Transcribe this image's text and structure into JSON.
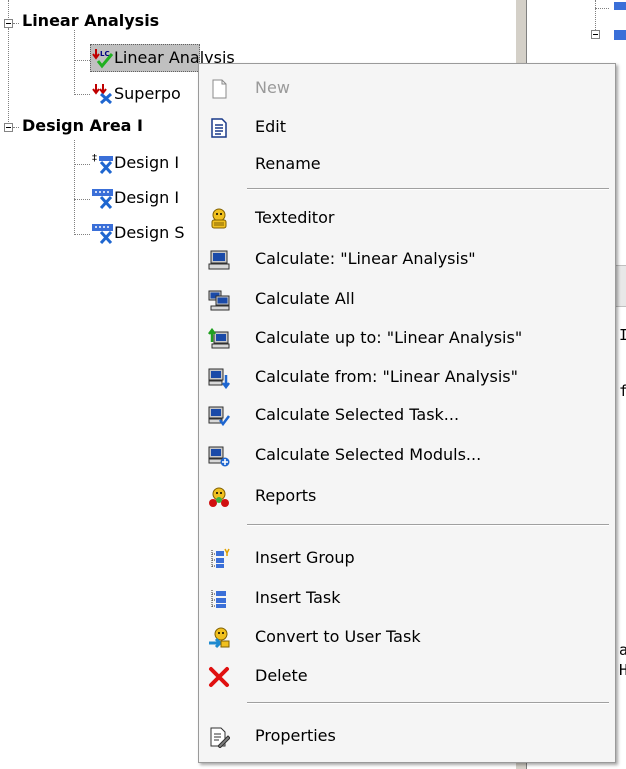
{
  "tree": {
    "nodes": [
      {
        "label": "Linear Analysis",
        "bold": true
      },
      {
        "label": "Linear Analysis",
        "bold": false
      },
      {
        "label": "Superpo",
        "bold": false
      },
      {
        "label": "Design Area I",
        "bold": true
      },
      {
        "label": "Design I",
        "bold": false
      },
      {
        "label": "Design I",
        "bold": false
      },
      {
        "label": "Design S",
        "bold": false
      }
    ]
  },
  "right_pane": {
    "chars": [
      "I",
      "f",
      "a",
      "H"
    ]
  },
  "context_menu": {
    "items": [
      {
        "label": "New",
        "icon": "new-document-icon",
        "enabled": false
      },
      {
        "label": "Edit",
        "icon": "edit-document-icon",
        "enabled": true
      },
      {
        "label": "Rename",
        "icon": "",
        "enabled": true
      },
      {
        "label": "Texteditor",
        "icon": "texteditor-icon",
        "enabled": true
      },
      {
        "label": "Calculate: \"Linear Analysis\"",
        "icon": "calculate-icon",
        "enabled": true
      },
      {
        "label": "Calculate All",
        "icon": "calculate-all-icon",
        "enabled": true
      },
      {
        "label": "Calculate up to: \"Linear Analysis\"",
        "icon": "calculate-up-to-icon",
        "enabled": true
      },
      {
        "label": "Calculate from: \"Linear Analysis\"",
        "icon": "calculate-from-icon",
        "enabled": true
      },
      {
        "label": "Calculate Selected Task...",
        "icon": "calculate-selected-task-icon",
        "enabled": true
      },
      {
        "label": "Calculate Selected Moduls...",
        "icon": "calculate-selected-moduls-icon",
        "enabled": true
      },
      {
        "label": "Reports",
        "icon": "reports-icon",
        "enabled": true
      },
      {
        "label": "Insert Group",
        "icon": "insert-group-icon",
        "enabled": true
      },
      {
        "label": "Insert Task",
        "icon": "insert-task-icon",
        "enabled": true
      },
      {
        "label": "Convert to User Task",
        "icon": "convert-user-task-icon",
        "enabled": true
      },
      {
        "label": "Delete",
        "icon": "delete-icon",
        "enabled": true
      },
      {
        "label": "Properties",
        "icon": "properties-icon",
        "enabled": true
      }
    ]
  },
  "colors": {
    "menu_background": "#f5f5f5",
    "disabled_text": "#9a9a9a",
    "selection_background": "#c0c0c0",
    "delete_red": "#e01010"
  }
}
